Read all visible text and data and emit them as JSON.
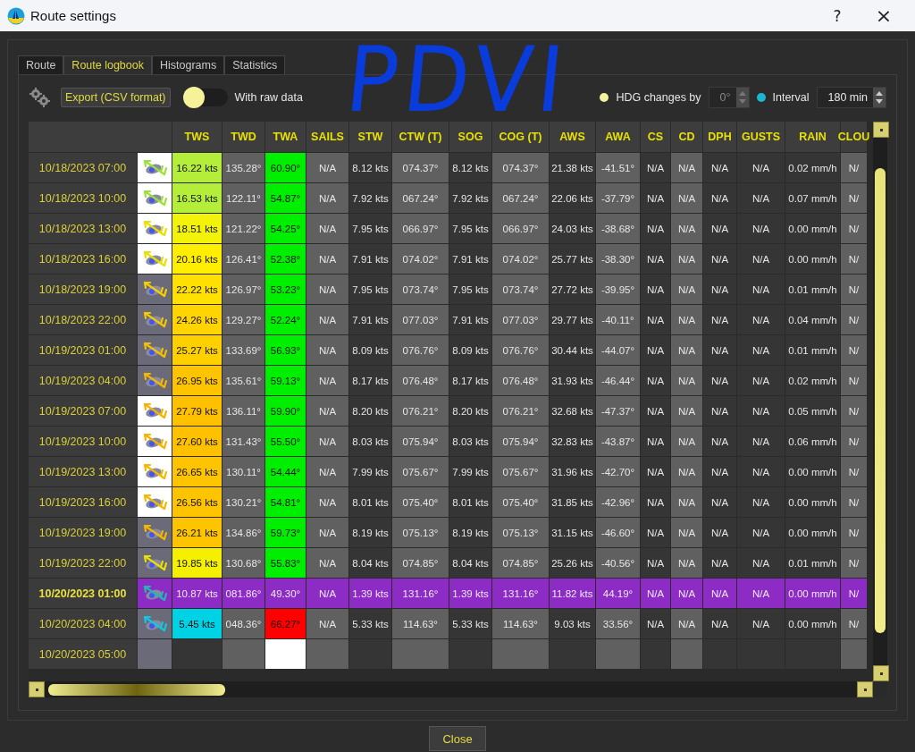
{
  "window": {
    "title": "Route settings",
    "help": "?",
    "close": "×"
  },
  "tabs": [
    {
      "label": "Route",
      "selected": false
    },
    {
      "label": "Route logbook",
      "selected": true
    },
    {
      "label": "Histograms",
      "selected": false
    },
    {
      "label": "Statistics",
      "selected": false
    }
  ],
  "annotation": "PDVI",
  "toolbar": {
    "export_button": "Export (CSV format)",
    "raw_data": {
      "label": "With raw data",
      "on": false
    },
    "modes": [
      {
        "label": "HDG changes by",
        "selected": false,
        "value": "0°",
        "disabled": true
      },
      {
        "label": "Interval",
        "selected": true,
        "value": "180 min",
        "disabled": false
      }
    ]
  },
  "table": {
    "columns": [
      "TWS",
      "TWD",
      "TWA",
      "SAILS",
      "STW",
      "CTW (T)",
      "SOG",
      "COG (T)",
      "AWS",
      "AWA",
      "CS",
      "CD",
      "DPH",
      "GUSTS",
      "RAIN",
      "CLOU"
    ],
    "rows": [
      {
        "date": "10/18/2023 07:00",
        "highlighted": false,
        "icon": {
          "daylight": true,
          "color": "#9ee03a"
        },
        "tws": {
          "text": "16.22 kts",
          "color": "#b5ee3a"
        },
        "twd": "135.28°",
        "twa": {
          "text": "60.90°",
          "color": "#00ee00"
        },
        "rest": [
          "N/A",
          "8.12 kts",
          "074.37°",
          "8.12 kts",
          "074.37°",
          "21.38 kts",
          "-41.51°",
          "N/A",
          "N/A",
          "N/A",
          "N/A",
          "0.02 mm/h",
          "N/"
        ]
      },
      {
        "date": "10/18/2023 10:00",
        "highlighted": false,
        "icon": {
          "daylight": true,
          "color": "#9ee03a"
        },
        "tws": {
          "text": "16.53 kts",
          "color": "#b5ee3a"
        },
        "twd": "122.11°",
        "twa": {
          "text": "54.87°",
          "color": "#00ee00"
        },
        "rest": [
          "N/A",
          "7.92 kts",
          "067.24°",
          "7.92 kts",
          "067.24°",
          "22.06 kts",
          "-37.79°",
          "N/A",
          "N/A",
          "N/A",
          "N/A",
          "0.07 mm/h",
          "N/"
        ]
      },
      {
        "date": "10/18/2023 13:00",
        "highlighted": false,
        "icon": {
          "daylight": true,
          "color": "#e8e000"
        },
        "tws": {
          "text": "18.51 kts",
          "color": "#f2f20a"
        },
        "twd": "121.22°",
        "twa": {
          "text": "54.25°",
          "color": "#00ee00"
        },
        "rest": [
          "N/A",
          "7.95 kts",
          "066.97°",
          "7.95 kts",
          "066.97°",
          "24.03 kts",
          "-38.68°",
          "N/A",
          "N/A",
          "N/A",
          "N/A",
          "0.00 mm/h",
          "N/"
        ]
      },
      {
        "date": "10/18/2023 16:00",
        "highlighted": false,
        "icon": {
          "daylight": true,
          "color": "#e8e000"
        },
        "tws": {
          "text": "20.16 kts",
          "color": "#ffee00"
        },
        "twd": "126.41°",
        "twa": {
          "text": "52.38°",
          "color": "#00ee00"
        },
        "rest": [
          "N/A",
          "7.91 kts",
          "074.02°",
          "7.91 kts",
          "074.02°",
          "25.77 kts",
          "-38.30°",
          "N/A",
          "N/A",
          "N/A",
          "N/A",
          "0.00 mm/h",
          "N/"
        ]
      },
      {
        "date": "10/18/2023 19:00",
        "highlighted": false,
        "icon": {
          "daylight": false,
          "color": "#f5d000"
        },
        "tws": {
          "text": "22.22 kts",
          "color": "#ffe000"
        },
        "twd": "126.97°",
        "twa": {
          "text": "53.23°",
          "color": "#00ee00"
        },
        "rest": [
          "N/A",
          "7.95 kts",
          "073.74°",
          "7.95 kts",
          "073.74°",
          "27.72 kts",
          "-39.95°",
          "N/A",
          "N/A",
          "N/A",
          "N/A",
          "0.01 mm/h",
          "N/"
        ]
      },
      {
        "date": "10/18/2023 22:00",
        "highlighted": false,
        "icon": {
          "daylight": false,
          "color": "#f5c800"
        },
        "tws": {
          "text": "24.26 kts",
          "color": "#ffd400"
        },
        "twd": "129.27°",
        "twa": {
          "text": "52.24°",
          "color": "#00ee00"
        },
        "rest": [
          "N/A",
          "7.91 kts",
          "077.03°",
          "7.91 kts",
          "077.03°",
          "29.77 kts",
          "-40.11°",
          "N/A",
          "N/A",
          "N/A",
          "N/A",
          "0.04 mm/h",
          "N/"
        ]
      },
      {
        "date": "10/19/2023 01:00",
        "highlighted": false,
        "icon": {
          "daylight": false,
          "color": "#f5c000"
        },
        "tws": {
          "text": "25.27 kts",
          "color": "#ffd000"
        },
        "twd": "133.69°",
        "twa": {
          "text": "56.93°",
          "color": "#00ee00"
        },
        "rest": [
          "N/A",
          "8.09 kts",
          "076.76°",
          "8.09 kts",
          "076.76°",
          "30.44 kts",
          "-44.07°",
          "N/A",
          "N/A",
          "N/A",
          "N/A",
          "0.01 mm/h",
          "N/"
        ]
      },
      {
        "date": "10/19/2023 04:00",
        "highlighted": false,
        "icon": {
          "daylight": false,
          "color": "#f5b800"
        },
        "tws": {
          "text": "26.95 kts",
          "color": "#ffc400"
        },
        "twd": "135.61°",
        "twa": {
          "text": "59.13°",
          "color": "#00ee00"
        },
        "rest": [
          "N/A",
          "8.17 kts",
          "076.48°",
          "8.17 kts",
          "076.48°",
          "31.93 kts",
          "-46.44°",
          "N/A",
          "N/A",
          "N/A",
          "N/A",
          "0.02 mm/h",
          "N/"
        ]
      },
      {
        "date": "10/19/2023 07:00",
        "highlighted": false,
        "icon": {
          "daylight": true,
          "color": "#f5b400"
        },
        "tws": {
          "text": "27.79 kts",
          "color": "#ffc000"
        },
        "twd": "136.11°",
        "twa": {
          "text": "59.90°",
          "color": "#00ee00"
        },
        "rest": [
          "N/A",
          "8.20 kts",
          "076.21°",
          "8.20 kts",
          "076.21°",
          "32.68 kts",
          "-47.37°",
          "N/A",
          "N/A",
          "N/A",
          "N/A",
          "0.05 mm/h",
          "N/"
        ]
      },
      {
        "date": "10/19/2023 10:00",
        "highlighted": false,
        "icon": {
          "daylight": true,
          "color": "#f5b400"
        },
        "tws": {
          "text": "27.60 kts",
          "color": "#ffc000"
        },
        "twd": "131.43°",
        "twa": {
          "text": "55.50°",
          "color": "#00ee00"
        },
        "rest": [
          "N/A",
          "8.03 kts",
          "075.94°",
          "8.03 kts",
          "075.94°",
          "32.83 kts",
          "-43.87°",
          "N/A",
          "N/A",
          "N/A",
          "N/A",
          "0.06 mm/h",
          "N/"
        ]
      },
      {
        "date": "10/19/2023 13:00",
        "highlighted": false,
        "icon": {
          "daylight": true,
          "color": "#f5b800"
        },
        "tws": {
          "text": "26.65 kts",
          "color": "#ffc400"
        },
        "twd": "130.11°",
        "twa": {
          "text": "54.44°",
          "color": "#00ee00"
        },
        "rest": [
          "N/A",
          "7.99 kts",
          "075.67°",
          "7.99 kts",
          "075.67°",
          "31.96 kts",
          "-42.70°",
          "N/A",
          "N/A",
          "N/A",
          "N/A",
          "0.00 mm/h",
          "N/"
        ]
      },
      {
        "date": "10/19/2023 16:00",
        "highlighted": false,
        "icon": {
          "daylight": true,
          "color": "#f5b800"
        },
        "tws": {
          "text": "26.56 kts",
          "color": "#ffc400"
        },
        "twd": "130.21°",
        "twa": {
          "text": "54.81°",
          "color": "#00ee00"
        },
        "rest": [
          "N/A",
          "8.01 kts",
          "075.40°",
          "8.01 kts",
          "075.40°",
          "31.85 kts",
          "-42.96°",
          "N/A",
          "N/A",
          "N/A",
          "N/A",
          "0.00 mm/h",
          "N/"
        ]
      },
      {
        "date": "10/19/2023 19:00",
        "highlighted": false,
        "icon": {
          "daylight": false,
          "color": "#f5b800"
        },
        "tws": {
          "text": "26.21 kts",
          "color": "#ffc400"
        },
        "twd": "134.86°",
        "twa": {
          "text": "59.73°",
          "color": "#00ee00"
        },
        "rest": [
          "N/A",
          "8.19 kts",
          "075.13°",
          "8.19 kts",
          "075.13°",
          "31.15 kts",
          "-46.60°",
          "N/A",
          "N/A",
          "N/A",
          "N/A",
          "0.00 mm/h",
          "N/"
        ]
      },
      {
        "date": "10/19/2023 22:00",
        "highlighted": false,
        "icon": {
          "daylight": false,
          "color": "#e8e000"
        },
        "tws": {
          "text": "19.85 kts",
          "color": "#f5f000"
        },
        "twd": "130.68°",
        "twa": {
          "text": "55.83°",
          "color": "#00ee00"
        },
        "rest": [
          "N/A",
          "8.04 kts",
          "074.85°",
          "8.04 kts",
          "074.85°",
          "25.26 kts",
          "-40.56°",
          "N/A",
          "N/A",
          "N/A",
          "N/A",
          "0.01 mm/h",
          "N/"
        ]
      },
      {
        "date": "10/20/2023 01:00",
        "highlighted": true,
        "icon": {
          "color": "#20b8b0"
        },
        "tws": {
          "text": "10.87 kts"
        },
        "twd": "081.86°",
        "twa": {
          "text": "49.30°"
        },
        "rest": [
          "N/A",
          "1.39 kts",
          "131.16°",
          "1.39 kts",
          "131.16°",
          "11.82 kts",
          "44.19°",
          "N/A",
          "N/A",
          "N/A",
          "N/A",
          "0.00 mm/h",
          "N/"
        ]
      },
      {
        "date": "10/20/2023 04:00",
        "highlighted": false,
        "icon": {
          "daylight": false,
          "color": "#10c8e0"
        },
        "tws": {
          "text": "5.45 kts",
          "color": "#00d2e6"
        },
        "twd": "048.36°",
        "twa": {
          "text": "66.27°",
          "color": "#ff0000"
        },
        "rest": [
          "N/A",
          "5.33 kts",
          "114.63°",
          "5.33 kts",
          "114.63°",
          "9.03 kts",
          "33.56°",
          "N/A",
          "N/A",
          "N/A",
          "N/A",
          "0.00 mm/h",
          "N/"
        ]
      },
      {
        "date": "10/20/2023 05:00",
        "highlighted": false,
        "icon": {
          "daylight": false
        },
        "twa": {
          "color": "#ffffff"
        }
      }
    ]
  },
  "footer": {
    "close_button": "Close"
  }
}
